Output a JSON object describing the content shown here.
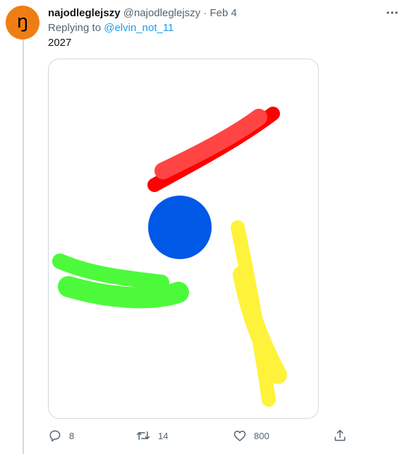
{
  "tweet": {
    "avatar_letter": "ŋ",
    "display_name": "najodleglejszy",
    "handle": "@najodleglejszy",
    "separator": "·",
    "date": "Feb 4",
    "replying_prefix": "Replying to ",
    "replying_to": "@elvin_not_11",
    "text": "2027"
  },
  "actions": {
    "replies": "8",
    "retweets": "14",
    "likes": "800"
  },
  "colors": {
    "avatar_bg": "#f07d14",
    "link": "#1d9bf0",
    "muted": "#536471",
    "stroke_red": "#ff0000",
    "stroke_light_red": "#ff4444",
    "circle_blue": "#0058e6",
    "stroke_green": "#4dfa3b",
    "stroke_yellow": "#fff23a"
  },
  "icons": [
    "more-icon",
    "reply-icon",
    "retweet-icon",
    "like-icon",
    "share-icon"
  ]
}
